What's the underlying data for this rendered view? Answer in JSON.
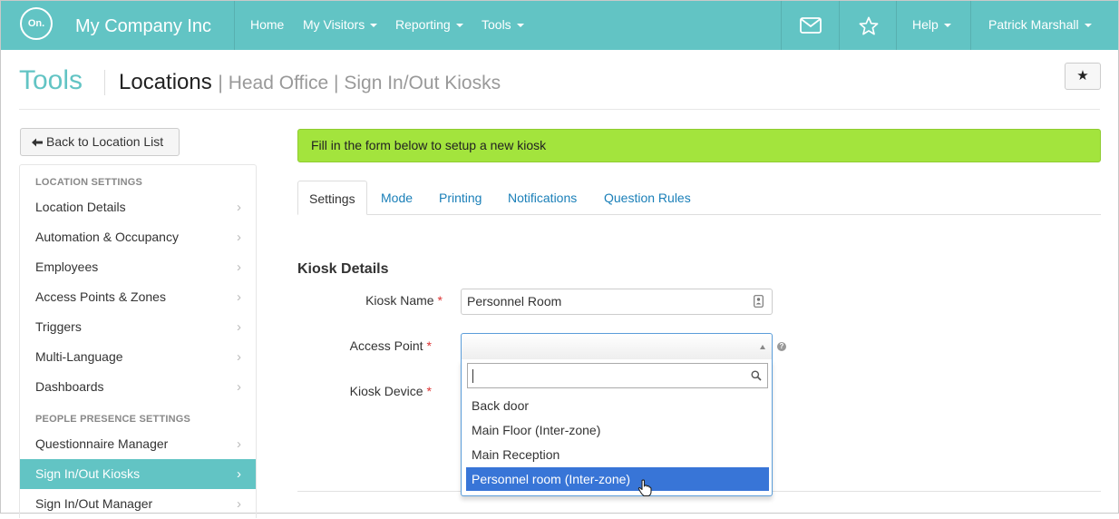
{
  "app": {
    "logo_text": "On.",
    "company": "My Company Inc"
  },
  "nav": {
    "home": "Home",
    "my_visitors": "My Visitors",
    "reporting": "Reporting",
    "tools": "Tools",
    "help": "Help",
    "user": "Patrick Marshall"
  },
  "header": {
    "section": "Tools",
    "title": "Locations",
    "crumb": "| Head Office | Sign In/Out Kiosks",
    "favorite_glyph": "★"
  },
  "sidebar": {
    "back_label": "Back to Location List",
    "heading_location": "LOCATION SETTINGS",
    "items_location": [
      "Location Details",
      "Automation & Occupancy",
      "Employees",
      "Access Points & Zones",
      "Triggers",
      "Multi-Language",
      "Dashboards"
    ],
    "heading_presence": "PEOPLE PRESENCE SETTINGS",
    "items_presence": [
      "Questionnaire Manager",
      "Sign In/Out Kiosks",
      "Sign In/Out Manager"
    ],
    "active_item": "Sign In/Out Kiosks"
  },
  "main": {
    "alert": "Fill in the form below to setup a new kiosk",
    "tabs": [
      "Settings",
      "Mode",
      "Printing",
      "Notifications",
      "Question Rules"
    ],
    "active_tab": "Settings",
    "section_heading": "Kiosk Details",
    "form": {
      "kiosk_name_label": "Kiosk Name",
      "kiosk_name_value": "Personnel Room",
      "access_point_label": "Access Point",
      "access_point_value": "",
      "kiosk_device_label": "Kiosk Device",
      "required_mark": "*",
      "help_glyph": "?"
    },
    "dropdown": {
      "search_value": "",
      "options": [
        "Back door",
        "Main Floor (Inter-zone)",
        "Main Reception",
        "Personnel room (Inter-zone)"
      ],
      "highlighted": "Personnel room (Inter-zone)"
    }
  },
  "colors": {
    "brand": "#62c4c4",
    "alert": "#a3e43d",
    "link": "#1a7fb8",
    "highlight": "#3875d7"
  }
}
